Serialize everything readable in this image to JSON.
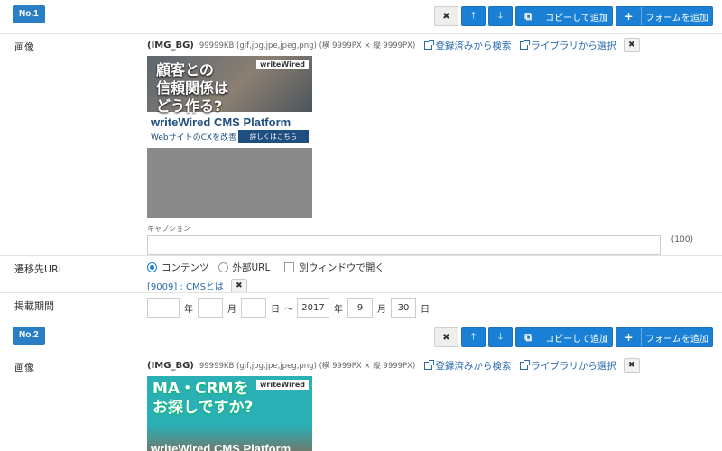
{
  "colors": {
    "accent": "#1a80d5",
    "badge": "#2a7ec6",
    "link": "#2a6bb0"
  },
  "toolbar": {
    "delete_icon": "✖",
    "up_icon": "🡑",
    "down_icon": "🡓",
    "copy_icon": "⧉",
    "copy_label": "コピーして追加",
    "add_icon": "+",
    "add_label": "フォームを追加"
  },
  "blocks": [
    {
      "badge": "No.1",
      "image_label": "画像",
      "image_key": "(IMG_BG)",
      "image_spec": "99999KB (gif,jpg,jpe,jpeg,png) (横 9999PX × 縦 9999PX)",
      "link_registered": "登録済みから検索",
      "link_library": "ライブラリから選択",
      "banner": {
        "title": "顧客との\n信頼関係は\nどう作る?",
        "brand": "writeWired",
        "product": "writeWired CMS Platform",
        "sub": "WebサイトのCXを改善",
        "cta": "詳しくはこちら"
      },
      "caption_label": "キャプション",
      "caption_counter": "(100)",
      "url_label": "遷移先URL",
      "radio_contents": "コンテンツ",
      "radio_external": "外部URL",
      "checkbox_new_window": "別ウィンドウで開く",
      "linked_content": "[9009] : CMSとは",
      "period_label": "掲載期間",
      "date": {
        "year_unit": "年",
        "month_unit": "月",
        "day_unit": "日",
        "tilde": "〜",
        "end_year": "2017",
        "end_month": "9",
        "end_day": "30"
      }
    },
    {
      "badge": "No.2",
      "image_label": "画像",
      "image_key": "(IMG_BG)",
      "image_spec": "99999KB (gif,jpg,jpe,jpeg,png) (横 9999PX × 縦 9999PX)",
      "link_registered": "登録済みから検索",
      "link_library": "ライブラリから選択",
      "banner": {
        "title": "MA・CRMを\nお探しですか?",
        "brand": "writeWired",
        "product": "writeWired CMS Platform"
      }
    }
  ]
}
